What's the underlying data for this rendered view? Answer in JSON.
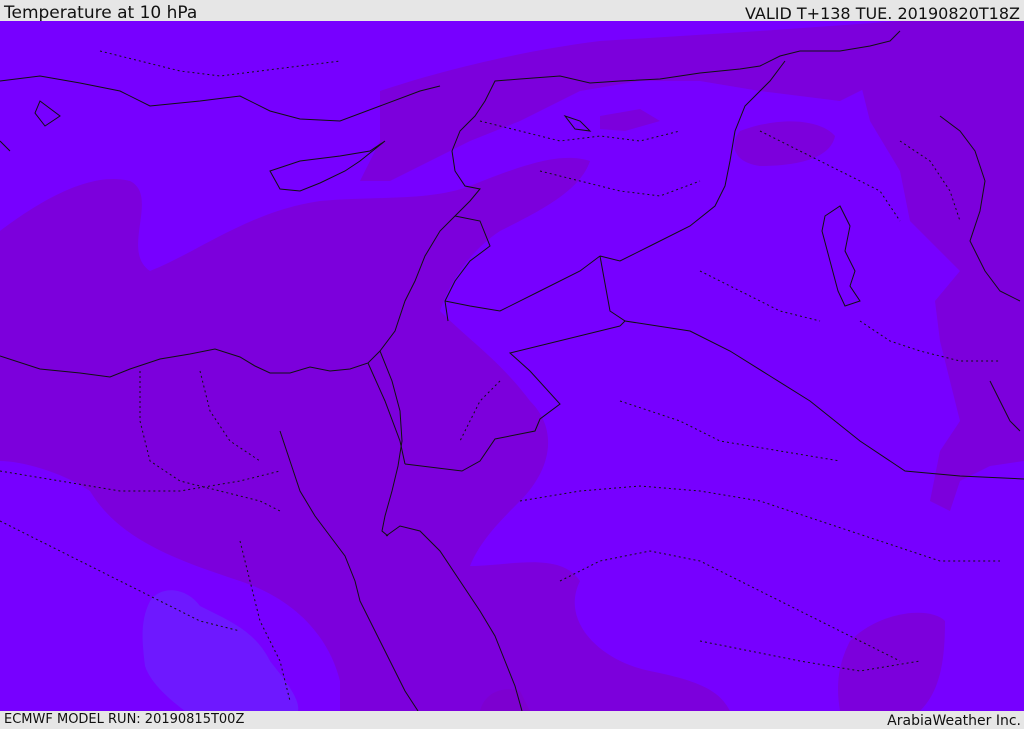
{
  "header": {
    "title": "Temperature at 10 hPa",
    "valid_time": "VALID T+138 TUE. 20190820T18Z"
  },
  "footer": {
    "model_run": "ECMWF MODEL RUN: 20190815T00Z",
    "credit": "ArabiaWeather Inc."
  },
  "colors": {
    "field_base": "#7700ff",
    "field_darker": "#7c00dc",
    "field_darkest": "#7d00d0",
    "field_lighter": "#6e18ff",
    "boundary_line": "#111111"
  }
}
